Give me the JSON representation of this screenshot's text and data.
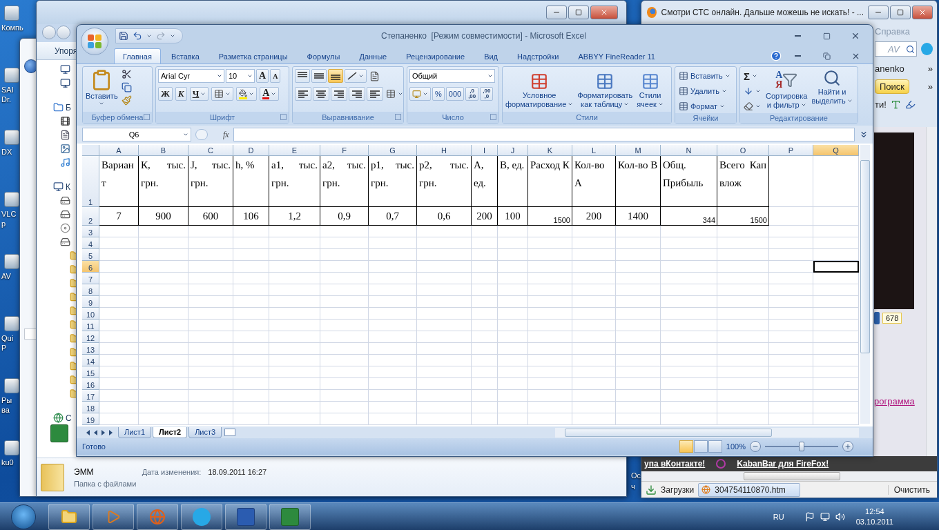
{
  "desktop_icons": [
    {
      "label": "Компь"
    },
    {
      "label": "SAI Dr."
    },
    {
      "label": "DX"
    },
    {
      "label": "VLC p"
    },
    {
      "label": "AV"
    },
    {
      "label": "Qui P"
    },
    {
      "label": "Ры ва"
    },
    {
      "label": "ku0"
    }
  ],
  "desktop_side_label": "Ос ч",
  "explorer": {
    "toolbar": "Упоря",
    "nav": [
      "Б",
      "К",
      "С"
    ],
    "details": {
      "name": "ЭММ",
      "date_label": "Дата изменения:",
      "date": "18.09.2011 16:27",
      "type": "Папка с файлами"
    }
  },
  "firefox": {
    "title": "Смотри СТС онлайн. Дальше можешь не искать! - ...",
    "menu": "Справка",
    "search_value": "AV",
    "bookmark": "anenko",
    "chevrons": [
      "»",
      "»"
    ],
    "search_button": "Поиск",
    "toolbar_text": "ти!",
    "counter": "678",
    "link": "рограмма",
    "footer_links": [
      "упа вКонтакте!",
      "KabanBar для FireFox!"
    ],
    "downloads": {
      "title": "Загрузки",
      "file": "304754110870.htm",
      "clear": "Очистить"
    }
  },
  "excel": {
    "title": "Степаненко  [Режим совместимости] - Microsoft Excel",
    "tabs": [
      {
        "label": "Главная",
        "selected": true
      },
      {
        "label": "Вставка",
        "selected": false
      },
      {
        "label": "Разметка страницы",
        "selected": false
      },
      {
        "label": "Формулы",
        "selected": false
      },
      {
        "label": "Данные",
        "selected": false
      },
      {
        "label": "Рецензирование",
        "selected": false
      },
      {
        "label": "Вид",
        "selected": false
      },
      {
        "label": "Надстройки",
        "selected": false
      },
      {
        "label": "ABBYY FineReader 11",
        "selected": false
      }
    ],
    "ribbon_groups": [
      {
        "kind": "clipboard",
        "label": "Буфер обмена",
        "paste": "Вставить"
      },
      {
        "kind": "font",
        "label": "Шрифт",
        "font": "Arial Cyr",
        "size": "10",
        "grow": "A",
        "shrink": "A",
        "bold": "Ж",
        "italic": "К",
        "underline": "Ч",
        "color_letter": "A"
      },
      {
        "kind": "alignment",
        "label": "Выравнивание",
        "vertical_align": [
          {
            "selected": false
          },
          {
            "selected": false
          },
          {
            "selected": true
          }
        ]
      },
      {
        "kind": "number",
        "label": "Число",
        "format": "Общий",
        "percent": "%",
        "thousands": "000",
        "increase_decimal": [
          ",0",
          ",00"
        ],
        "decrease_decimal": [
          ",00",
          ",0"
        ]
      },
      {
        "kind": "styles",
        "label": "Стили",
        "buttons": [
          [
            "Условное",
            "форматирование"
          ],
          [
            "Форматировать",
            "как таблицу"
          ],
          [
            "Стили",
            "ячеек"
          ]
        ]
      },
      {
        "kind": "cells",
        "label": "Ячейки",
        "buttons": [
          "Вставить",
          "Удалить",
          "Формат"
        ]
      },
      {
        "kind": "editing",
        "label": "Редактирование",
        "sum": "Σ",
        "sort": [
          "Сортировка",
          "и фильтр"
        ],
        "sort_glyphs": [
          "A",
          "Я"
        ],
        "find": [
          "Найти и",
          "выделить"
        ]
      }
    ],
    "name_box": "Q6",
    "fx": "fx",
    "grid": {
      "columns": [
        {
          "label": "A",
          "selected": false
        },
        {
          "label": "B",
          "selected": false
        },
        {
          "label": "C",
          "selected": false
        },
        {
          "label": "D",
          "selected": false
        },
        {
          "label": "E",
          "selected": false
        },
        {
          "label": "F",
          "selected": false
        },
        {
          "label": "G",
          "selected": false
        },
        {
          "label": "H",
          "selected": false
        },
        {
          "label": "I",
          "selected": false
        },
        {
          "label": "J",
          "selected": false
        },
        {
          "label": "K",
          "selected": false
        },
        {
          "label": "L",
          "selected": false
        },
        {
          "label": "M",
          "selected": false
        },
        {
          "label": "N",
          "selected": false
        },
        {
          "label": "O",
          "selected": false
        },
        {
          "label": "P",
          "selected": false
        },
        {
          "label": "Q",
          "selected": true
        }
      ],
      "rows": [
        {
          "number": "1",
          "selected": false,
          "cells": [
            {
              "text": "Вариант",
              "kind": "heading"
            },
            {
              "text": "К, тыс. грн.",
              "kind": "heading"
            },
            {
              "text": "J, тыс. грн.",
              "kind": "heading"
            },
            {
              "text": "h, %",
              "kind": "heading"
            },
            {
              "text": "а1, тыс. грн.",
              "kind": "heading"
            },
            {
              "text": "а2, тыс. грн.",
              "kind": "heading"
            },
            {
              "text": "р1, тыс. грн.",
              "kind": "heading"
            },
            {
              "text": "р2, тыс. грн.",
              "kind": "heading"
            },
            {
              "text": "А, ед.",
              "kind": "heading"
            },
            {
              "text": "В, ед.",
              "kind": "heading"
            },
            {
              "text": "Расход К",
              "kind": "heading"
            },
            {
              "text": "Кол-во А",
              "kind": "heading"
            },
            {
              "text": "Кол-во В",
              "kind": "heading"
            },
            {
              "text": "Общ. Прибыль",
              "kind": "heading"
            },
            {
              "text": "Всего Кап влож",
              "kind": "heading"
            }
          ]
        },
        {
          "number": "2",
          "selected": false,
          "cells": [
            {
              "text": "7",
              "kind": "value"
            },
            {
              "text": "900",
              "kind": "value"
            },
            {
              "text": "600",
              "kind": "value"
            },
            {
              "text": "106",
              "kind": "value"
            },
            {
              "text": "1,2",
              "kind": "value"
            },
            {
              "text": "0,9",
              "kind": "value"
            },
            {
              "text": "0,7",
              "kind": "value"
            },
            {
              "text": "0,6",
              "kind": "value"
            },
            {
              "text": "200",
              "kind": "value"
            },
            {
              "text": "100",
              "kind": "value"
            },
            {
              "text": "1500",
              "kind": "number"
            },
            {
              "text": "200",
              "kind": "value"
            },
            {
              "text": "1400",
              "kind": "value"
            },
            {
              "text": "344",
              "kind": "number"
            },
            {
              "text": "1500",
              "kind": "number"
            }
          ]
        },
        {
          "number": "3",
          "selected": false
        },
        {
          "number": "4",
          "selected": false
        },
        {
          "number": "5",
          "selected": false
        },
        {
          "number": "6",
          "selected": true
        },
        {
          "number": "7",
          "selected": false
        },
        {
          "number": "8",
          "selected": false
        },
        {
          "number": "9",
          "selected": false
        },
        {
          "number": "10",
          "selected": false
        },
        {
          "number": "11",
          "selected": false
        },
        {
          "number": "12",
          "selected": false
        },
        {
          "number": "13",
          "selected": false
        },
        {
          "number": "14",
          "selected": false
        },
        {
          "number": "15",
          "selected": false
        },
        {
          "number": "16",
          "selected": false
        },
        {
          "number": "17",
          "selected": false
        },
        {
          "number": "18",
          "selected": false
        },
        {
          "number": "19",
          "selected": false
        }
      ]
    },
    "sheet_tabs": [
      {
        "label": "Лист1",
        "selected": false
      },
      {
        "label": "Лист2",
        "selected": true
      },
      {
        "label": "Лист3",
        "selected": false
      }
    ],
    "status": {
      "text": "Готово",
      "views": [
        {
          "selected": true
        },
        {
          "selected": false
        },
        {
          "selected": false
        }
      ],
      "zoom": {
        "label": "100%",
        "level": 0.5
      }
    }
  },
  "taskbar": {
    "language": "RU",
    "time": "12:54",
    "date": "03.10.2011"
  }
}
